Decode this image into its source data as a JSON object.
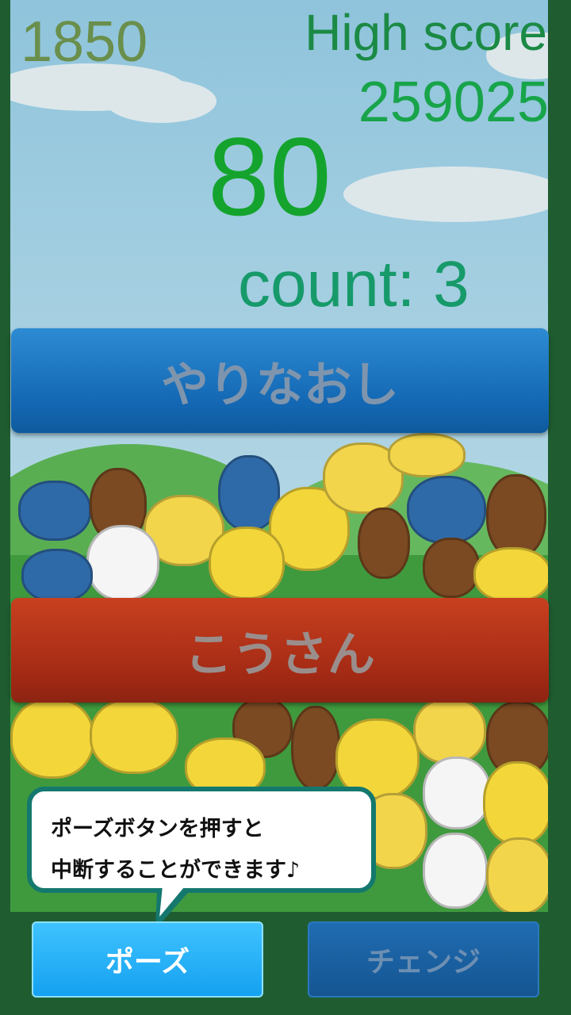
{
  "hud": {
    "score": "1850",
    "high_score_label": "High score",
    "high_score_value": "259025",
    "timer": "80",
    "count": "count: 3"
  },
  "buttons": {
    "retry_label": "やりなおし",
    "give_up_label": "こうさん",
    "pause_label": "ポーズ",
    "change_label": "チェンジ"
  },
  "tooltip": {
    "line1": "ポーズボタンを押すと",
    "line2": "中断することができます♪"
  },
  "colors": {
    "frame": "#1f5d31",
    "retry": "#1468b4",
    "give_up": "#a52b15",
    "pause": "#15a1f0",
    "change": "#155592"
  }
}
